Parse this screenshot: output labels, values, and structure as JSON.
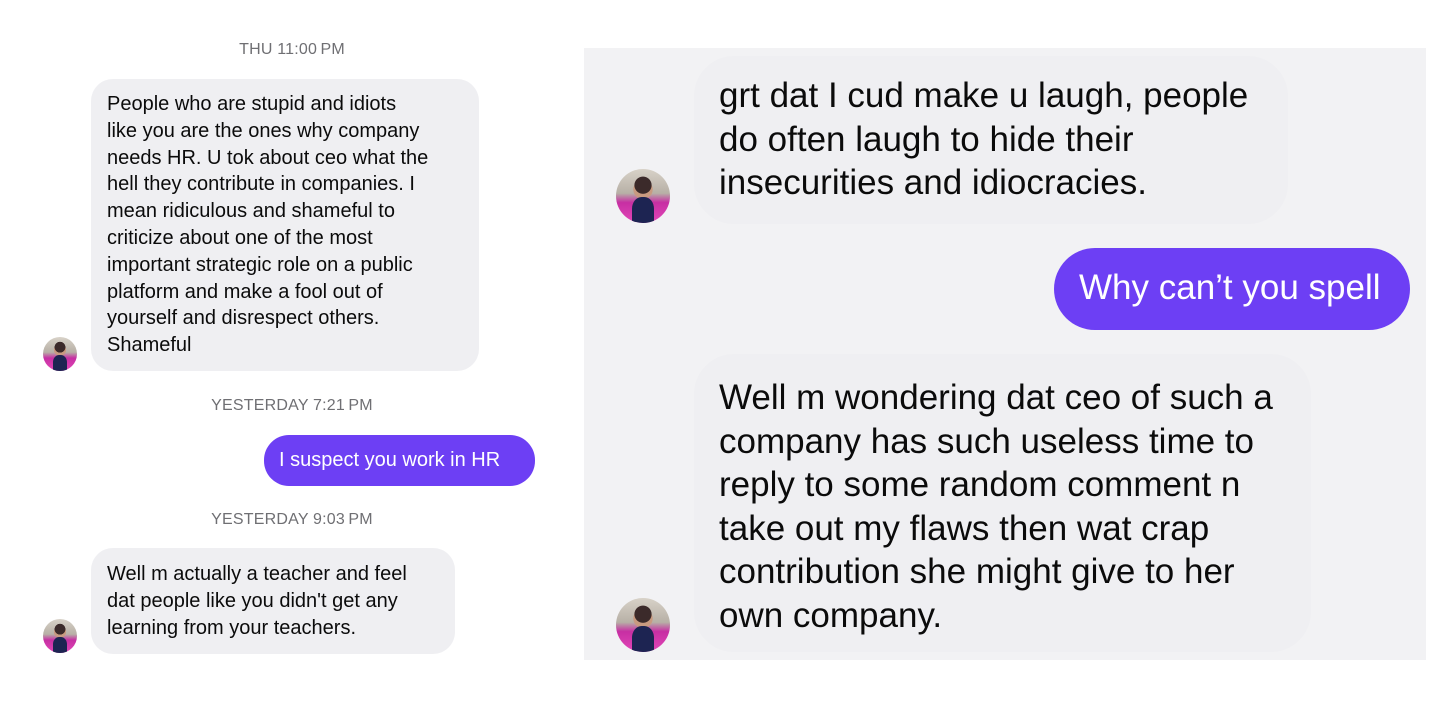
{
  "left_thread": {
    "timestamps": [
      "THU 11:00 PM",
      "YESTERDAY 7:21 PM",
      "YESTERDAY 9:03 PM"
    ],
    "messages": [
      {
        "direction": "incoming",
        "text": "People who are stupid and idiots\nlike you are the ones why company\nneeds HR. U tok about ceo what the\nhell they contribute in companies. I\nmean ridiculous and shameful to\ncriticize about one of the most\nimportant strategic role on a public\nplatform and make a fool out of\nyourself and disrespect others.\nShameful"
      },
      {
        "direction": "outgoing",
        "text": "I suspect you work in HR"
      },
      {
        "direction": "incoming",
        "text": "Well m actually a teacher and feel\ndat people like you didn't get any\nlearning from your teachers."
      }
    ]
  },
  "right_thread": {
    "messages": [
      {
        "direction": "incoming",
        "text": "grt dat I cud make u laugh, people\ndo often laugh to hide their\ninsecurities and idiocracies."
      },
      {
        "direction": "outgoing",
        "text": "Why can’t you spell"
      },
      {
        "direction": "incoming",
        "text": "Well m wondering dat ceo of such a\ncompany has such useless time to\nreply to some random comment n\ntake out my flaws then wat crap\ncontribution she might give to her\nown company."
      }
    ]
  },
  "colors": {
    "outgoing_bubble": "#6d3ff4",
    "incoming_bubble": "#efeff2",
    "timestamp_text": "#6f6f73"
  }
}
